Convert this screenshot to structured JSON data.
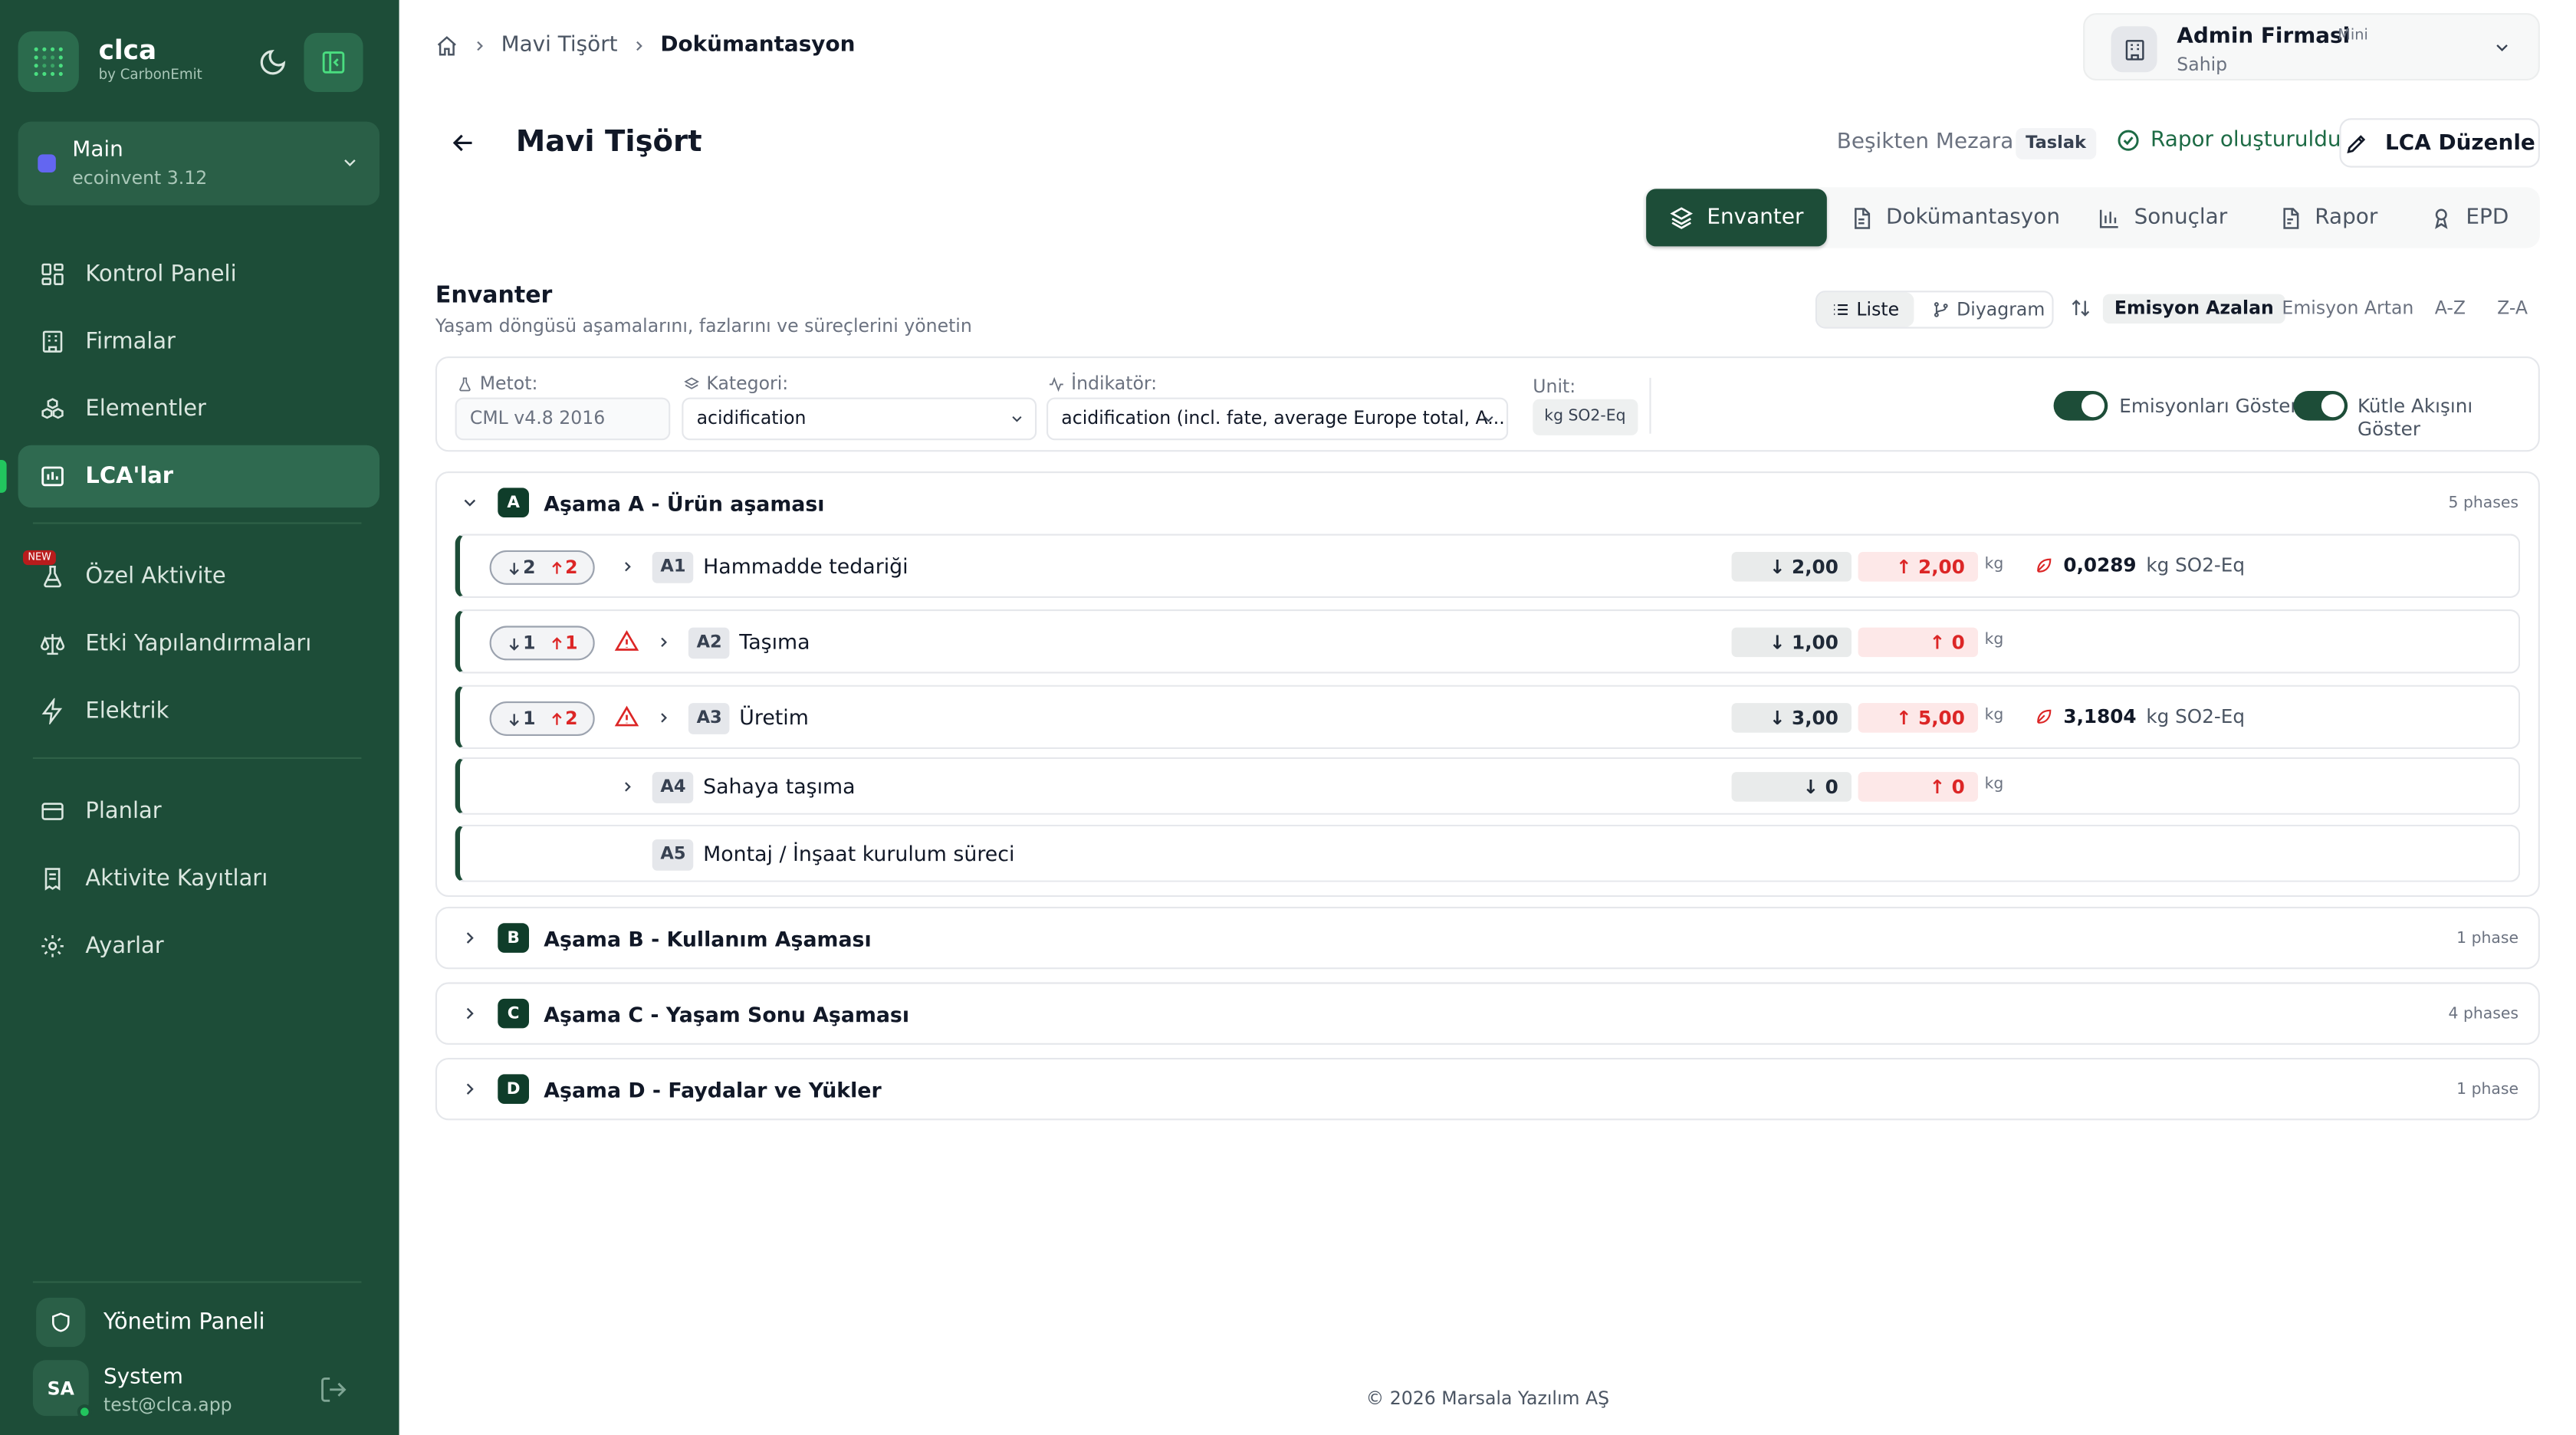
{
  "sidebar": {
    "brand": "clca",
    "brand_sub": "by CarbonEmit",
    "project": {
      "name": "Main",
      "db": "ecoinvent 3.12"
    },
    "items": [
      {
        "label": "Kontrol Paneli"
      },
      {
        "label": "Firmalar"
      },
      {
        "label": "Elementler"
      },
      {
        "label": "LCA'lar"
      },
      {
        "label": "Özel Aktivite"
      },
      {
        "label": "Etki Yapılandırmaları"
      },
      {
        "label": "Elektrik"
      },
      {
        "label": "Planlar"
      },
      {
        "label": "Aktivite Kayıtları"
      },
      {
        "label": "Ayarlar"
      }
    ],
    "new_badge": "NEW",
    "admin_panel": "Yönetim Paneli",
    "user": {
      "initials": "SA",
      "name": "System",
      "email": "test@clca.app"
    },
    "accent": "#22c55e",
    "bg": "#1d4d38"
  },
  "header": {
    "breadcrumb": [
      "Mavi Tişört",
      "Dokümantasyon"
    ],
    "company": {
      "name": "Admin Firmasi",
      "plan": "Mini",
      "role": "Sahip"
    },
    "title": "Mavi Tişört",
    "scope": "Beşikten Mezara",
    "status": "Taslak",
    "report_status": "Rapor oluşturuldu",
    "edit_label": "LCA Düzenle",
    "tabs": [
      {
        "label": "Envanter"
      },
      {
        "label": "Dokümantasyon"
      },
      {
        "label": "Sonuçlar"
      },
      {
        "label": "Rapor"
      },
      {
        "label": "EPD"
      }
    ]
  },
  "inventory": {
    "title": "Envanter",
    "subtitle": "Yaşam döngüsü aşamalarını, fazlarını ve süreçlerini yönetin",
    "views": [
      "Liste",
      "Diyagram"
    ],
    "sort": [
      "Emisyon Azalan",
      "Emisyon Artan",
      "A-Z",
      "Z-A"
    ],
    "filters": {
      "method_label": "Metot:",
      "method_value": "CML v4.8 2016",
      "category_label": "Kategori:",
      "category_value": "acidification",
      "indicator_label": "İndikatör:",
      "indicator_value": "acidification (incl. fate, average Europe total, A...",
      "unit_label": "Unit:",
      "unit_value": "kg SO2-Eq",
      "toggle_emissions": "Emisyonları Göster",
      "toggle_mass": "Kütle Akışını Göster"
    },
    "stages": [
      {
        "code": "A",
        "name": "Aşama A - Ürün aşaması",
        "count": "5 phases",
        "phases": [
          {
            "code": "A1",
            "name": "Hammadde tedariği",
            "pill_in": "2",
            "pill_out": "2",
            "in": "2,00",
            "out": "2,00",
            "unit": "kg",
            "emission": "0,0289",
            "emission_unit": "kg SO2-Eq"
          },
          {
            "code": "A2",
            "name": "Taşıma",
            "pill_in": "1",
            "pill_out": "1",
            "in": "1,00",
            "out": "0",
            "unit": "kg"
          },
          {
            "code": "A3",
            "name": "Üretim",
            "pill_in": "1",
            "pill_out": "2",
            "in": "3,00",
            "out": "5,00",
            "unit": "kg",
            "emission": "3,1804",
            "emission_unit": "kg SO2-Eq"
          },
          {
            "code": "A4",
            "name": "Sahaya taşıma",
            "in": "0",
            "out": "0",
            "unit": "kg"
          },
          {
            "code": "A5",
            "name": "Montaj / İnşaat kurulum süreci"
          }
        ]
      },
      {
        "code": "B",
        "name": "Aşama B - Kullanım Aşaması",
        "count": "1 phase"
      },
      {
        "code": "C",
        "name": "Aşama C - Yaşam Sonu Aşaması",
        "count": "4 phases"
      },
      {
        "code": "D",
        "name": "Aşama D - Faydalar ve Yükler",
        "count": "1 phase"
      }
    ]
  },
  "footer": "© 2026 Marsala Yazılım AŞ"
}
